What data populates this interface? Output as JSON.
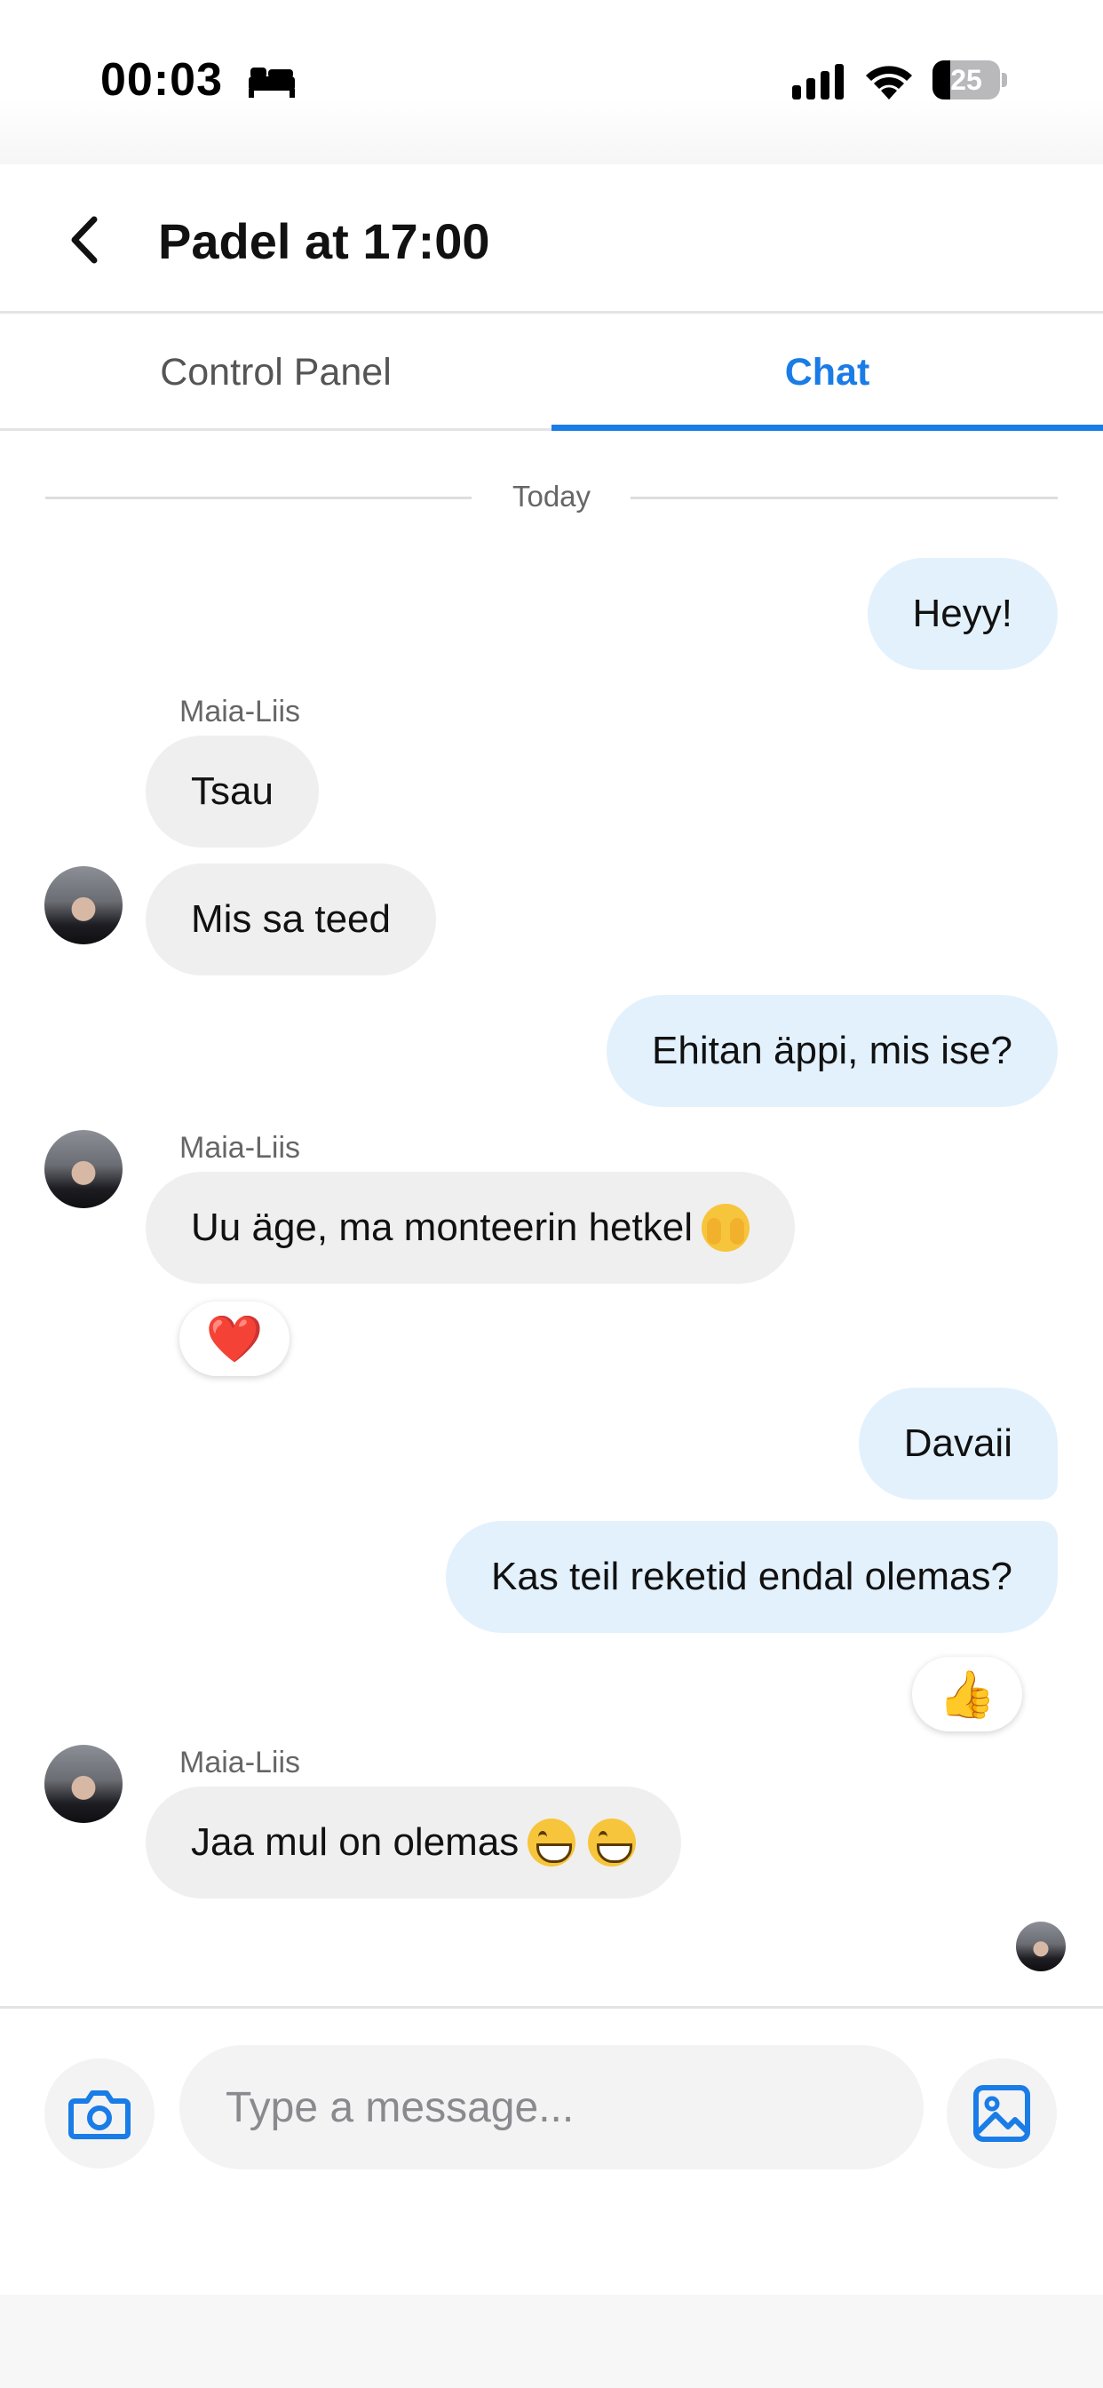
{
  "status_bar": {
    "time": "00:03",
    "battery": "25",
    "icons": [
      "bed-icon",
      "signal-icon",
      "wifi-icon",
      "battery-icon"
    ]
  },
  "header": {
    "title": "Padel at 17:00",
    "back_icon": "chevron-left-icon"
  },
  "tabs": [
    {
      "label": "Control Panel",
      "active": false
    },
    {
      "label": "Chat",
      "active": true
    }
  ],
  "colors": {
    "accent": "#1a7ce6",
    "outgoing_bubble": "#e3f1fd",
    "incoming_bubble": "#efefef"
  },
  "chat": {
    "date_divider": "Today",
    "messages": [
      {
        "direction": "out",
        "text": "Heyy!"
      },
      {
        "direction": "in",
        "sender": "Maia-Liis",
        "text": "Tsau"
      },
      {
        "direction": "in",
        "text": "Mis sa teed"
      },
      {
        "direction": "out",
        "text": "Ehitan äppi, mis ise?"
      },
      {
        "direction": "in",
        "sender": "Maia-Liis",
        "text": "Uu äge, ma monteerin hetkel",
        "emoji": "face-with-peeking-eye",
        "reaction": "❤️"
      },
      {
        "direction": "out",
        "text": "Davaii"
      },
      {
        "direction": "out",
        "text": "Kas teil reketid endal olemas?",
        "reaction": "👍"
      },
      {
        "direction": "in",
        "sender": "Maia-Liis",
        "text": "Jaa mul on olemas",
        "emoji": "grinning-face x2"
      }
    ]
  },
  "input": {
    "placeholder": "Type a message...",
    "value": "",
    "camera_icon": "camera-icon",
    "gallery_icon": "image-icon"
  }
}
